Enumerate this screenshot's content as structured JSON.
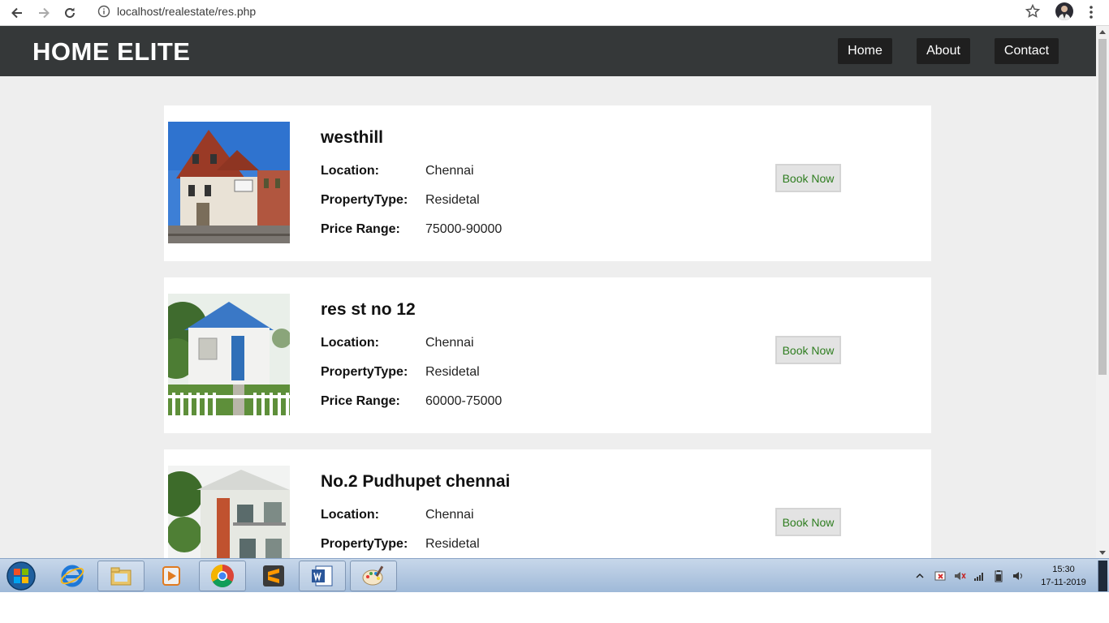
{
  "browser": {
    "url": "localhost/realestate/res.php"
  },
  "header": {
    "brand": "HOME ELITE",
    "nav": [
      {
        "label": "Home"
      },
      {
        "label": "About"
      },
      {
        "label": "Contact"
      }
    ]
  },
  "labels": {
    "location": "Location:",
    "property_type": "PropertyType:",
    "price_range": "Price Range:",
    "book": "Book Now"
  },
  "listings": [
    {
      "name": "westhill",
      "location": "Chennai",
      "property_type": "Residetal",
      "price_range": "75000-90000"
    },
    {
      "name": "res st no 12",
      "location": "Chennai",
      "property_type": "Residetal",
      "price_range": "60000-75000"
    },
    {
      "name": "No.2 Pudhupet chennai",
      "location": "Chennai",
      "property_type": "Residetal",
      "price_range": ""
    }
  ],
  "taskbar": {
    "time": "15:30",
    "date": "17-11-2019",
    "apps": [
      "start-orb-icon",
      "internet-explorer-icon",
      "file-explorer-icon",
      "media-player-icon",
      "chrome-icon",
      "sublime-text-icon",
      "word-icon",
      "paint-icon"
    ]
  }
}
